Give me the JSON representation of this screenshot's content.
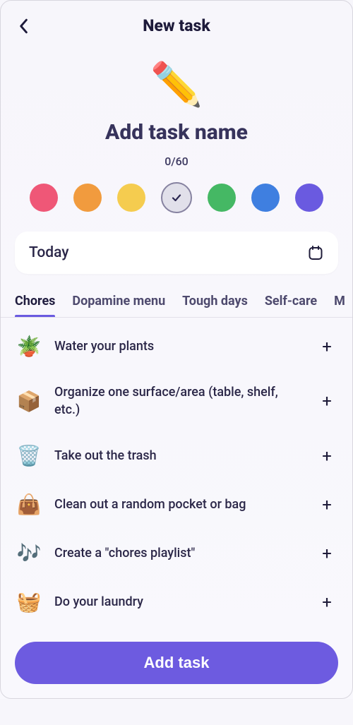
{
  "header": {
    "title": "New task"
  },
  "editor": {
    "icon": "✏️",
    "prompt": "Add task name",
    "counter": "0/60"
  },
  "colors": {
    "options": [
      {
        "hex": "#ef5777",
        "selected": false
      },
      {
        "hex": "#f19b3e",
        "selected": false
      },
      {
        "hex": "#f5cc4f",
        "selected": false
      },
      {
        "hex": "#e1e0ea",
        "selected": true
      },
      {
        "hex": "#45b864",
        "selected": false
      },
      {
        "hex": "#3f7fe0",
        "selected": false
      },
      {
        "hex": "#6a5ae0",
        "selected": false
      }
    ]
  },
  "date": {
    "label": "Today"
  },
  "tabs": {
    "items": [
      {
        "label": "Chores",
        "active": true
      },
      {
        "label": "Dopamine menu",
        "active": false
      },
      {
        "label": "Tough days",
        "active": false
      },
      {
        "label": "Self-care",
        "active": false
      },
      {
        "label": "M",
        "active": false
      }
    ]
  },
  "suggestions": [
    {
      "emoji": "🪴",
      "text": "Water your plants"
    },
    {
      "emoji": "📦",
      "text": "Organize one surface/area (table, shelf, etc.)"
    },
    {
      "emoji": "🗑️",
      "text": "Take out the trash"
    },
    {
      "emoji": "👜",
      "text": "Clean out a random pocket or bag"
    },
    {
      "emoji": "🎶",
      "text": "Create a \"chores playlist\""
    },
    {
      "emoji": "🧺",
      "text": "Do your laundry"
    }
  ],
  "cta": {
    "label": "Add task"
  }
}
